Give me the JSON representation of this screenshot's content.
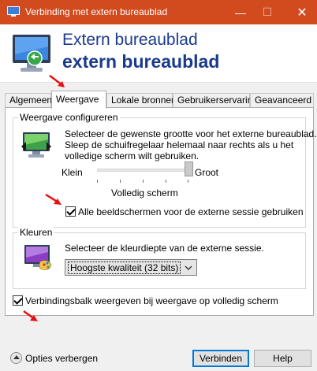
{
  "window": {
    "title": "Verbinding met extern bureaublad",
    "min_glyph": "—",
    "max_glyph": "☐",
    "close_glyph": "✕"
  },
  "header": {
    "line1": "Extern bureaublad",
    "line2": "extern bureaublad"
  },
  "tabs": [
    "Algemeen",
    "Weergave",
    "Lokale bronnen",
    "Gebruikerservaring",
    "Geavanceerd"
  ],
  "active_tab": "Weergave",
  "display_group": {
    "label": "Weergave configureren",
    "description_line1": "Selecteer de gewenste grootte voor het externe bureaublad.",
    "description_line2": "Sleep de schuifregelaar helemaal naar rechts als u het",
    "description_line3": "volledige scherm wilt gebruiken.",
    "slider_min_label": "Klein",
    "slider_max_label": "Groot",
    "slider_value_label": "Volledig scherm",
    "slider_position": 1.0,
    "use_all_monitors": {
      "label": "Alle beeldschermen voor de externe sessie gebruiken",
      "checked": true
    }
  },
  "colors_group": {
    "label": "Kleuren",
    "description": "Selecteer de kleurdiepte van de externe sessie.",
    "depth_selected": "Hoogste kwaliteit (32 bits)"
  },
  "connection_bar": {
    "label": "Verbindingsbalk weergeven bij weergave op volledig scherm",
    "checked": true
  },
  "footer": {
    "options_toggle": "Opties verbergen",
    "connect_button": "Verbinden",
    "help_button": "Help"
  },
  "icons": {
    "app": "remote-desktop-icon",
    "header": "remote-desktop-monitor-icon",
    "display": "display-settings-icon",
    "colors": "color-palette-icon"
  },
  "colors": {
    "titlebar": "#d14b1f",
    "header_text": "#1a3a8c",
    "annotation_arrow": "#e81010",
    "default_button_border": "#0078d7"
  }
}
